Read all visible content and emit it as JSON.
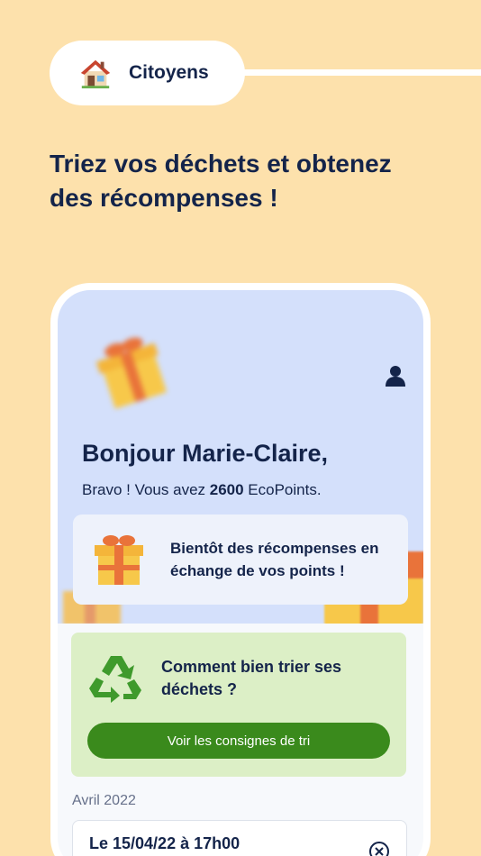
{
  "header": {
    "badge_label": "Citoyens",
    "badge_icon": "house-icon",
    "headline": "Triez vos déchets et obtenez des récompenses !"
  },
  "app": {
    "greeting": "Bonjour Marie-Claire,",
    "points_prefix": "Bravo ! Vous avez ",
    "points_value": "2600",
    "points_suffix": " EcoPoints.",
    "reward_card_text": "Bientôt des récompenses en échange de vos points !",
    "sort_card_title": "Comment bien trier ses déchets ?",
    "sort_button_label": "Voir les consignes de tri",
    "month_label": "Avril 2022",
    "event_date": "Le 15/04/22 à 17h00"
  },
  "colors": {
    "background": "#fde1ac",
    "hero": "#d4e0fb",
    "green_card": "#dcefc6",
    "button": "#3a8a1c",
    "text": "#14244a"
  }
}
